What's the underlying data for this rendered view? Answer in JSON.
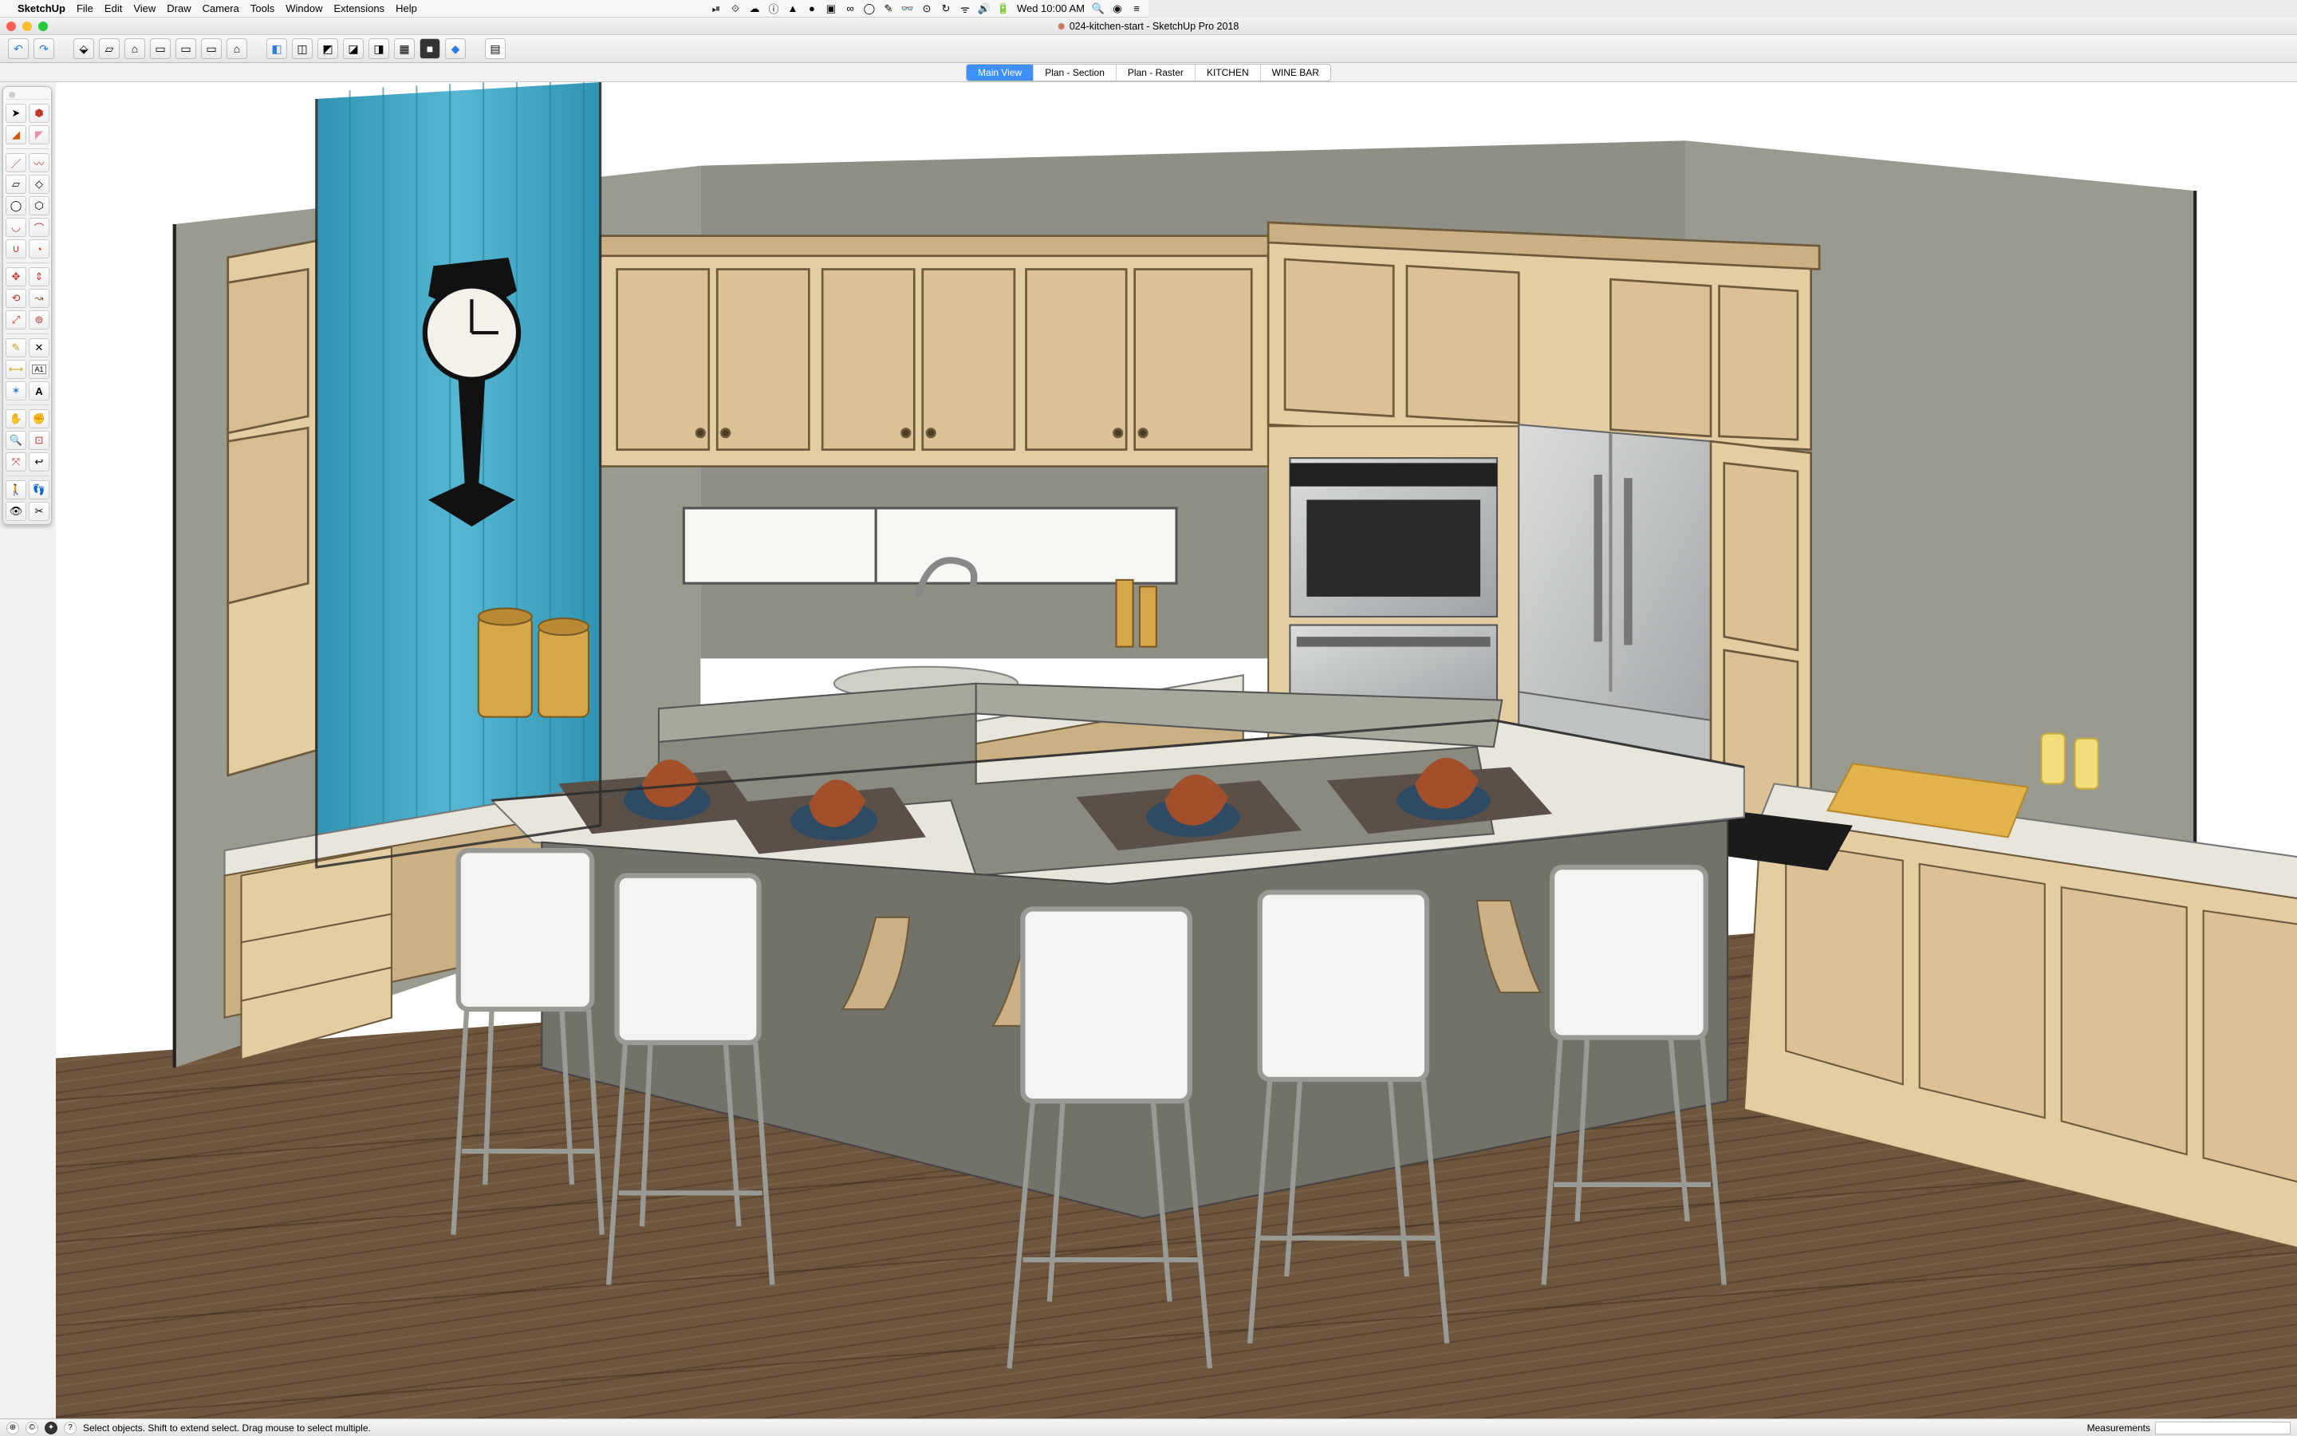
{
  "menubar": {
    "apple": "",
    "app": "SketchUp",
    "items": [
      "File",
      "Edit",
      "View",
      "Draw",
      "Camera",
      "Tools",
      "Window",
      "Extensions",
      "Help"
    ],
    "clock": "Wed 10:00 AM",
    "status_icons": [
      "video-icon",
      "dropbox-icon",
      "cloud-icon",
      "circle-i-icon",
      "flame-icon",
      "hat-icon",
      "display-icon",
      "infinity-icon",
      "square-icon",
      "evernote-icon",
      "glasses-icon",
      "record-icon",
      "history-icon",
      "wifi-icon",
      "volume-icon",
      "battery-icon"
    ]
  },
  "window": {
    "title": "024-kitchen-start - SketchUp Pro 2018",
    "dirty": true
  },
  "top_toolbar": {
    "groups": [
      [
        "undo",
        "redo"
      ],
      [
        "iso",
        "top",
        "front-house",
        "right",
        "back",
        "left",
        "house"
      ],
      [
        "style-shaded",
        "style-wire",
        "style-hidden",
        "style-shaded-tex",
        "style-mono",
        "style-xray",
        "style-back",
        "style-color"
      ],
      [
        "layers-panel"
      ]
    ]
  },
  "scenes": {
    "tabs": [
      {
        "label": "Main View",
        "active": true
      },
      {
        "label": "Plan - Section",
        "active": false
      },
      {
        "label": "Plan - Raster",
        "active": false
      },
      {
        "label": "KITCHEN",
        "active": false
      },
      {
        "label": "WINE BAR",
        "active": false
      }
    ]
  },
  "palette_tools": [
    "select",
    "paint",
    "eraser",
    "eraser-soft",
    "line",
    "freehand",
    "rectangle",
    "rect-rot",
    "circle",
    "polygon",
    "arc",
    "arc2",
    "arc3",
    "pie",
    "move",
    "rotate-copy",
    "rotate",
    "follow",
    "scale",
    "offset",
    "tape",
    "protractor",
    "dims",
    "text",
    "axes",
    "3dtext",
    "orbit",
    "pan",
    "zoom",
    "zoom-window",
    "zoom-ext",
    "prev-view",
    "position",
    "walk",
    "look",
    "section"
  ],
  "statusbar": {
    "hint": "Select objects. Shift to extend select. Drag mouse to select multiple.",
    "measure_label": "Measurements",
    "measure_value": ""
  },
  "colors": {
    "wall": "#9a9a90",
    "floor": "#6e553e",
    "cabinet": "#e5cda3",
    "cabinet_dark": "#cbb084",
    "counter": "#e8e5dc",
    "island": "#7c7c74",
    "steel": "#c7c9ca",
    "steel_dark": "#9fa2a4",
    "tile": "#3fa7c6",
    "chair": "#f4f4f2",
    "bowl": "#a2502c",
    "board": "#e2b24b"
  }
}
